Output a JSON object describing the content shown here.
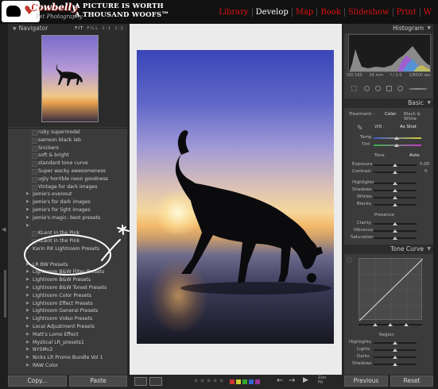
{
  "header": {
    "brand": "Cowbelly",
    "brand_sub": "Pet Photography",
    "tagline_line1": "A PICTURE IS WORTH",
    "tagline_line2": "A THOUSAND WOOFS",
    "tagline_mark": "tm",
    "modules": [
      {
        "label": "Library",
        "active": false
      },
      {
        "label": "Develop",
        "active": true
      },
      {
        "label": "Map",
        "active": false
      },
      {
        "label": "Book",
        "active": false
      },
      {
        "label": "Slideshow",
        "active": false
      },
      {
        "label": "Print",
        "active": false
      },
      {
        "label": "W",
        "active": false
      }
    ]
  },
  "navigator": {
    "title": "Navigator",
    "zoom_options": [
      "FIT",
      "FILL",
      "1:1",
      "1:2"
    ]
  },
  "presets": {
    "rows": [
      {
        "label": "ruby supermodel",
        "kind": "child"
      },
      {
        "label": "samson black lab",
        "kind": "child"
      },
      {
        "label": "Snickers",
        "kind": "child"
      },
      {
        "label": "soft & bright",
        "kind": "child"
      },
      {
        "label": "standard tone curve",
        "kind": "child"
      },
      {
        "label": "Super wacky awesomeness",
        "kind": "child"
      },
      {
        "label": "ugly horrible neon goodness",
        "kind": "child"
      },
      {
        "label": "Vintage for dark images",
        "kind": "child"
      },
      {
        "label": "Jamie's evenout",
        "kind": "folder"
      },
      {
        "label": "Jamie's for dark images",
        "kind": "folder"
      },
      {
        "label": "Jamie's for light images",
        "kind": "folder"
      },
      {
        "label": "Jamie's magic- best presets",
        "kind": "folder"
      },
      {
        "label": "",
        "kind": "folder"
      },
      {
        "label": "KLent in the Pink",
        "kind": "child"
      },
      {
        "label": "KLent In the Pink",
        "kind": "child"
      },
      {
        "label": "Karin RK Lightroom Presets",
        "kind": "folder"
      },
      {
        "label": "",
        "kind": "spacer"
      },
      {
        "label": "LR BW Presets",
        "kind": "folder"
      },
      {
        "label": "Lightroom B&W Filter Presets",
        "kind": "folder"
      },
      {
        "label": "Lightroom B&W Presets",
        "kind": "folder"
      },
      {
        "label": "Lightroom B&W Toned Presets",
        "kind": "folder"
      },
      {
        "label": "Lightroom Color Presets",
        "kind": "folder"
      },
      {
        "label": "Lightroom Effect Presets",
        "kind": "folder"
      },
      {
        "label": "Lightroom General Presets",
        "kind": "folder"
      },
      {
        "label": "Lightroom Video Presets",
        "kind": "folder"
      },
      {
        "label": "Local Adjustment Presets",
        "kind": "folder"
      },
      {
        "label": "Matt's Lomo Effect",
        "kind": "folder"
      },
      {
        "label": "Mystical LR_presets1",
        "kind": "folder"
      },
      {
        "label": "NYSMv2",
        "kind": "folder"
      },
      {
        "label": "Nicks LR Promo Bundle Vol 1",
        "kind": "folder"
      },
      {
        "label": "RAW Color",
        "kind": "folder"
      }
    ]
  },
  "left_footer": {
    "copy_label": "Copy...",
    "paste_label": "Paste"
  },
  "toolbar": {
    "zoom_label": "Zoo",
    "zoom_sub": "Fit"
  },
  "histogram": {
    "title": "Histogram",
    "iso": "ISO 160",
    "focal": "24 mm",
    "aperture": "f / 2.0",
    "shutter": "1/8000 sec"
  },
  "basic": {
    "title": "Basic",
    "treatment_label": "Treatment :",
    "treatment_color": "Color",
    "treatment_bw": "Black & White",
    "wb_label": "WB :",
    "wb_value": "As Shot",
    "temp_label": "Temp",
    "tint_label": "Tint",
    "tone_label": "Tone",
    "tone_auto": "Auto",
    "exposure_label": "Exposure",
    "exposure_value": "0.00",
    "contrast_label": "Contrast",
    "contrast_value": "0",
    "highlights_label": "Highlights",
    "shadows_label": "Shadows",
    "whites_label": "Whites",
    "blacks_label": "Blacks",
    "presence_label": "Presence",
    "clarity_label": "Clarity",
    "vibrance_label": "Vibrance",
    "saturation_label": "Saturation"
  },
  "tone_curve": {
    "title": "Tone Curve",
    "region_label": "Region",
    "highlights_label": "Highlights",
    "lights_label": "Lights",
    "darks_label": "Darks",
    "shadows_label": "Shadows"
  },
  "right_footer": {
    "previous_label": "Previous",
    "reset_label": "Reset"
  }
}
